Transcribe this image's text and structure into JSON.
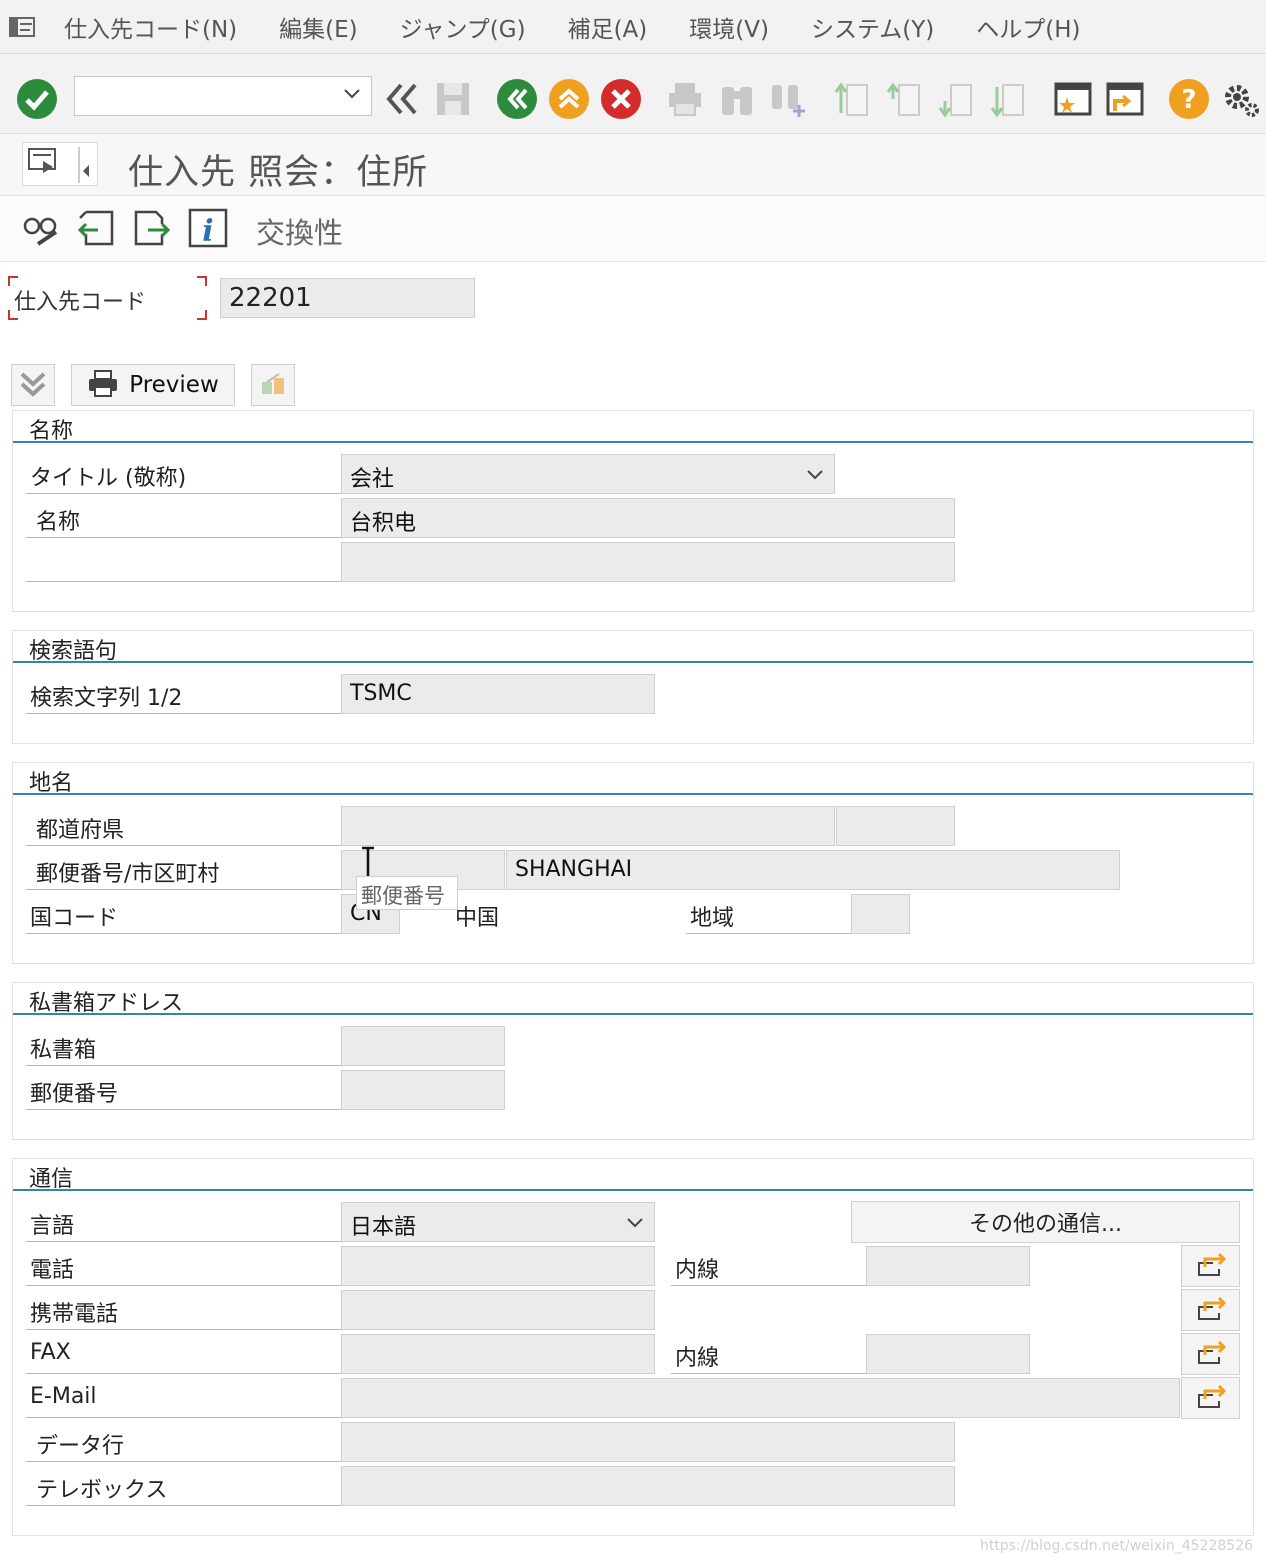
{
  "menu": {
    "items": [
      "仕入先コード(N)",
      "編集(E)",
      "ジャンプ(G)",
      "補足(A)",
      "環境(V)",
      "システム(Y)",
      "ヘルプ(H)"
    ]
  },
  "toolbar": {
    "command_field_value": ""
  },
  "title": "仕入先 照会：住所",
  "app_toolbar": {
    "label": "交換性"
  },
  "vendor": {
    "label": "仕入先コード",
    "value": "22201"
  },
  "buttons": {
    "preview": "Preview"
  },
  "sections": {
    "name": {
      "title": "名称",
      "title_label": "タイトル (敬称)",
      "title_value": "会社",
      "name_label": "名称",
      "name_value": "台积电",
      "name2_value": ""
    },
    "search": {
      "title": "検索語句",
      "term_label": "検索文字列 1/2",
      "term_value": "TSMC"
    },
    "location": {
      "title": "地名",
      "region_label": "都道府県",
      "postal_city_label": "郵便番号/市区町村",
      "city_value": "SHANGHAI",
      "country_label": "国コード",
      "country_value": "CN",
      "country_name": "中国",
      "area_label": "地域",
      "tooltip": "郵便番号"
    },
    "pobox": {
      "title": "私書箱アドレス",
      "box_label": "私書箱",
      "postal_label": "郵便番号"
    },
    "comm": {
      "title": "通信",
      "language_label": "言語",
      "language_value": "日本語",
      "other_button": "その他の通信...",
      "phone_label": "電話",
      "ext_label": "内線",
      "mobile_label": "携帯電話",
      "fax_label": "FAX",
      "fax_ext_label": "内線",
      "email_label": "E-Mail",
      "data_line_label": "データ行",
      "telebox_label": "テレボックス"
    }
  },
  "watermark": "https://blog.csdn.net/weixin_45228526",
  "colors": {
    "ok_green": "#2e8b3e",
    "nav_green": "#2e8b3e",
    "nav_orange": "#f0a020",
    "cancel_red": "#d42b2b",
    "help_orange": "#f0a020",
    "section_line": "#3a7fb8"
  }
}
